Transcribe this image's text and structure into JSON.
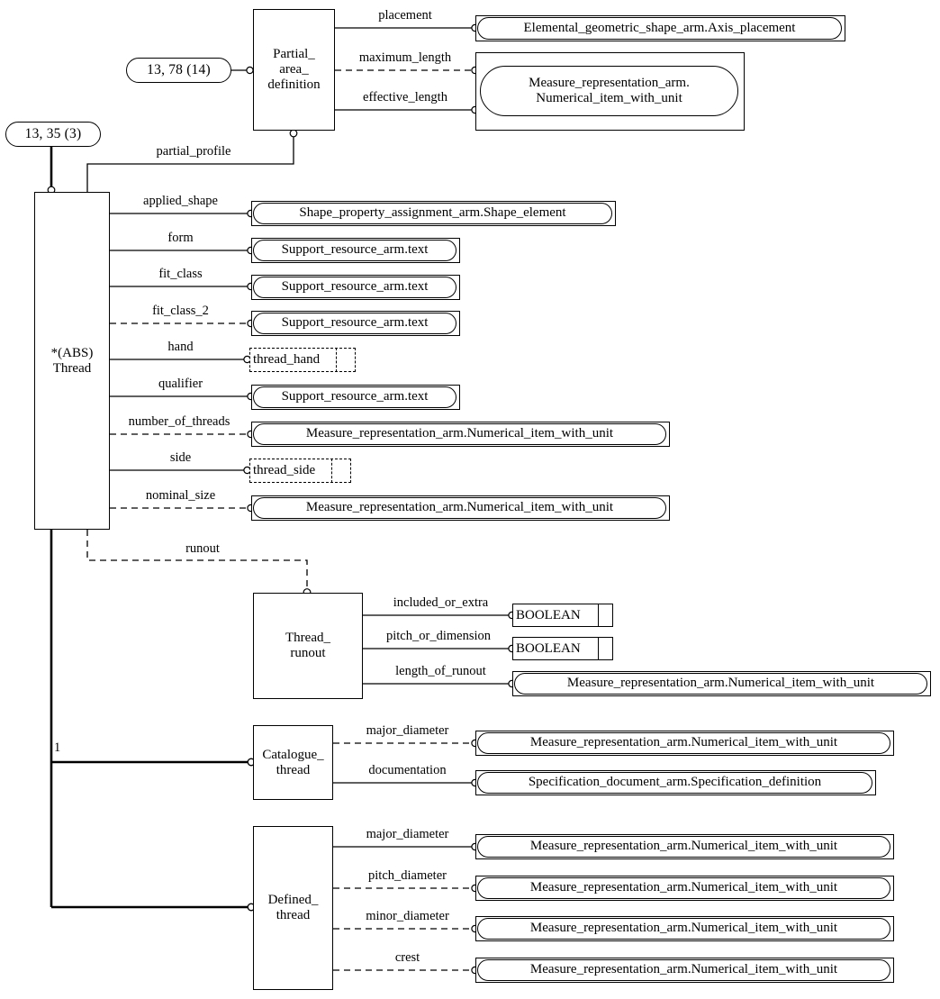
{
  "diagram": {
    "title": "Thread entity EXPRESS-G schema diagram",
    "notation": "EXPRESS-G"
  },
  "page_refs": [
    {
      "id": "ref-partial-area",
      "label": "13, 78 (14)"
    },
    {
      "id": "ref-thread",
      "label": "13, 35 (3)"
    }
  ],
  "entities": {
    "partial_area_definition": {
      "label": "Partial_\narea_\ndefinition"
    },
    "thread": {
      "label": "*(ABS)\nThread"
    },
    "thread_runout": {
      "label": "Thread_\nrunout"
    },
    "catalogue_thread": {
      "label": "Catalogue_\nthread"
    },
    "defined_thread": {
      "label": "Defined_\nthread"
    }
  },
  "types": {
    "axis_placement": {
      "label": "Elemental_geometric_shape_arm.Axis_placement"
    },
    "numerical_item": {
      "label": "Measure_representation_arm.\nNumerical_item_with_unit"
    },
    "shape_element": {
      "label": "Shape_property_assignment_arm.Shape_element"
    },
    "support_text": {
      "label": "Support_resource_arm.text"
    },
    "numerical_item_1l": {
      "label": "Measure_representation_arm.Numerical_item_with_unit"
    },
    "spec_definition": {
      "label": "Specification_document_arm.Specification_definition"
    },
    "thread_hand": {
      "label": "thread_hand"
    },
    "thread_side": {
      "label": "thread_side"
    },
    "boolean": {
      "label": "BOOLEAN"
    }
  },
  "attributes": {
    "partial_area_definition": [
      {
        "name": "placement",
        "optional": false
      },
      {
        "name": "maximum_length",
        "optional": true
      },
      {
        "name": "effective_length",
        "optional": false
      }
    ],
    "thread_inbound": [
      {
        "name": "partial_profile",
        "optional": false
      }
    ],
    "thread": [
      {
        "name": "applied_shape",
        "optional": false,
        "target": "Shape_property_assignment_arm.Shape_element"
      },
      {
        "name": "form",
        "optional": false,
        "target": "Support_resource_arm.text"
      },
      {
        "name": "fit_class",
        "optional": false,
        "target": "Support_resource_arm.text"
      },
      {
        "name": "fit_class_2",
        "optional": true,
        "target": "Support_resource_arm.text"
      },
      {
        "name": "hand",
        "optional": false,
        "target": "thread_hand"
      },
      {
        "name": "qualifier",
        "optional": false,
        "target": "Support_resource_arm.text"
      },
      {
        "name": "number_of_threads",
        "optional": true,
        "target": "Measure_representation_arm.Numerical_item_with_unit"
      },
      {
        "name": "side",
        "optional": false,
        "target": "thread_side"
      },
      {
        "name": "nominal_size",
        "optional": true,
        "target": "Measure_representation_arm.Numerical_item_with_unit"
      },
      {
        "name": "runout",
        "optional": true,
        "target": "Thread_runout"
      }
    ],
    "thread_runout": [
      {
        "name": "included_or_extra",
        "optional": false,
        "target": "BOOLEAN"
      },
      {
        "name": "pitch_or_dimension",
        "optional": false,
        "target": "BOOLEAN"
      },
      {
        "name": "length_of_runout",
        "optional": false,
        "target": "Measure_representation_arm.Numerical_item_with_unit"
      }
    ],
    "catalogue_thread": [
      {
        "name": "major_diameter",
        "optional": true,
        "target": "Measure_representation_arm.Numerical_item_with_unit"
      },
      {
        "name": "documentation",
        "optional": false,
        "target": "Specification_document_arm.Specification_definition"
      }
    ],
    "defined_thread": [
      {
        "name": "major_diameter",
        "optional": false,
        "target": "Measure_representation_arm.Numerical_item_with_unit"
      },
      {
        "name": "pitch_diameter",
        "optional": true,
        "target": "Measure_representation_arm.Numerical_item_with_unit"
      },
      {
        "name": "minor_diameter",
        "optional": true,
        "target": "Measure_representation_arm.Numerical_item_with_unit"
      },
      {
        "name": "crest",
        "optional": true,
        "target": "Measure_representation_arm.Numerical_item_with_unit"
      }
    ]
  },
  "supertype": {
    "label": "1",
    "parent": "Thread",
    "children": [
      "Catalogue_thread",
      "Defined_thread"
    ]
  },
  "colors": {
    "stroke": "#000000",
    "background": "#ffffff"
  }
}
